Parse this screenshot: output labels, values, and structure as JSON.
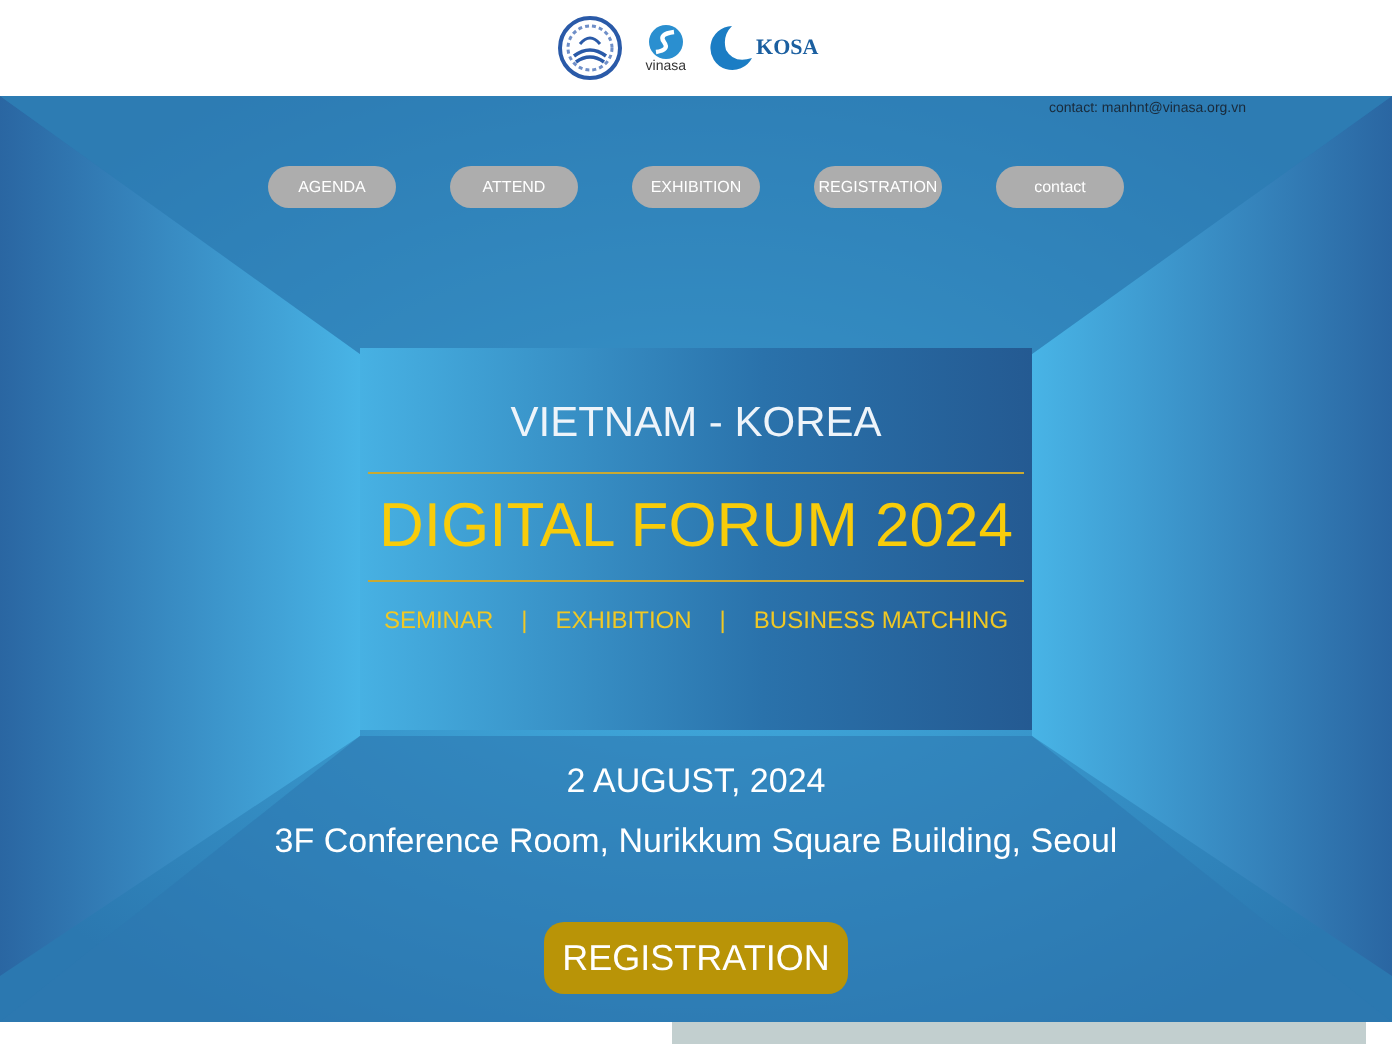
{
  "header": {
    "vinasa_label": "vinasa",
    "kosa_label": "KOSA"
  },
  "contact": "contact: manhnt@vinasa.org.vn",
  "nav": [
    "AGENDA",
    "ATTEND",
    "EXHIBITION",
    "REGISTRATION",
    "contact"
  ],
  "title_panel": {
    "subtitle": "VIETNAM - KOREA",
    "title": "DIGITAL FORUM 2024",
    "topics": [
      "SEMINAR",
      "EXHIBITION",
      "BUSINESS MATCHING"
    ],
    "separator": "|"
  },
  "date": "2 AUGUST, 2024",
  "venue": "3F Conference Room, Nurikkum Square Building, Seoul",
  "cta": "REGISTRATION"
}
